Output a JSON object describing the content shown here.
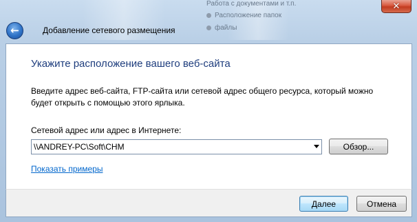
{
  "window": {
    "title": "Добавление сетевого размещения",
    "close_glyph": "✕",
    "back_glyph": "←"
  },
  "background_hints": [
    "Работа с документами и т.п.",
    "Расположение папок",
    "файлы"
  ],
  "page": {
    "heading": "Укажите расположение вашего веб-сайта",
    "description": "Введите адрес веб-сайта, FTP-сайта или сетевой адрес общего ресурса, который можно будет открыть с помощью этого ярлыка.",
    "field_label": "Сетевой адрес или адрес в Интернете:",
    "address_value": "\\\\ANDREY-PC\\Soft\\CHM",
    "browse_label": "Обзор...",
    "examples_link": "Показать примеры"
  },
  "footer": {
    "next_label": "Далее",
    "cancel_label": "Отмена"
  },
  "colors": {
    "heading": "#1e3d7d",
    "link": "#0066cc",
    "frame": "#b9cfe6",
    "close": "#c23b20"
  }
}
